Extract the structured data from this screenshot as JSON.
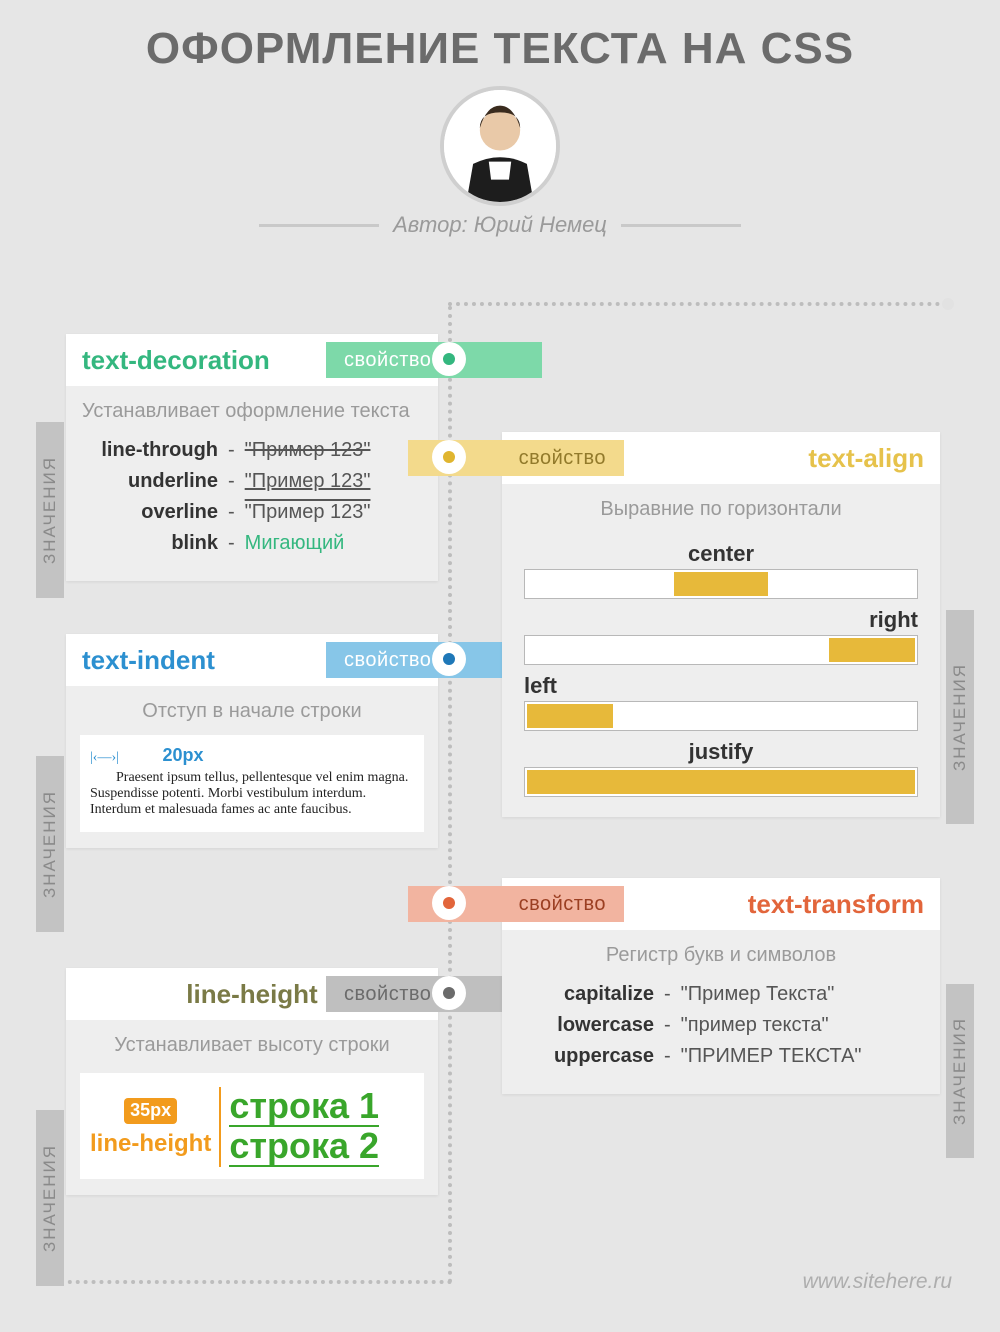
{
  "title": "ОФОРМЛЕНИЕ ТЕКСТА НА CSS",
  "author_prefix": "Автор:",
  "author_name": "Юрий Немец",
  "property_label": "свойство",
  "values_label": "ЗНАЧЕНИЯ",
  "watermark": "www.sitehere.ru",
  "text_decoration": {
    "name": "text-decoration",
    "desc": "Устанавливает оформление текста",
    "items": [
      {
        "name": "line-through",
        "example": "\"Пример 123\"",
        "style": "strike"
      },
      {
        "name": "underline",
        "example": "\"Пример 123\"",
        "style": "uline"
      },
      {
        "name": "overline",
        "example": "\"Пример 123\"",
        "style": "oline"
      },
      {
        "name": "blink",
        "example": "Мигающий",
        "style": "blink"
      }
    ]
  },
  "text_indent": {
    "name": "text-indent",
    "desc": "Отступ в начале строки",
    "value": "20px",
    "sample": "Praesent ipsum tellus, pellentesque vel enim magna. Suspendisse potenti. Morbi vestibulum interdum. Interdum et malesuada fames ac ante faucibus."
  },
  "line_height": {
    "name": "line-height",
    "desc": "Устанавливает высоту строки",
    "value": "35px",
    "label": "line-height",
    "line1": "строка 1",
    "line2": "строка 2"
  },
  "text_align": {
    "name": "text-align",
    "desc": "Выравние по горизонтали",
    "items": [
      "center",
      "right",
      "left",
      "justify"
    ]
  },
  "text_transform": {
    "name": "text-transform",
    "desc": "Регистр букв и символов",
    "items": [
      {
        "name": "capitalize",
        "example": "\"Пример Текста\""
      },
      {
        "name": "lowercase",
        "example": "\"пример текста\""
      },
      {
        "name": "uppercase",
        "example": "\"ПРИМЕР ТЕКСТА\""
      }
    ]
  }
}
